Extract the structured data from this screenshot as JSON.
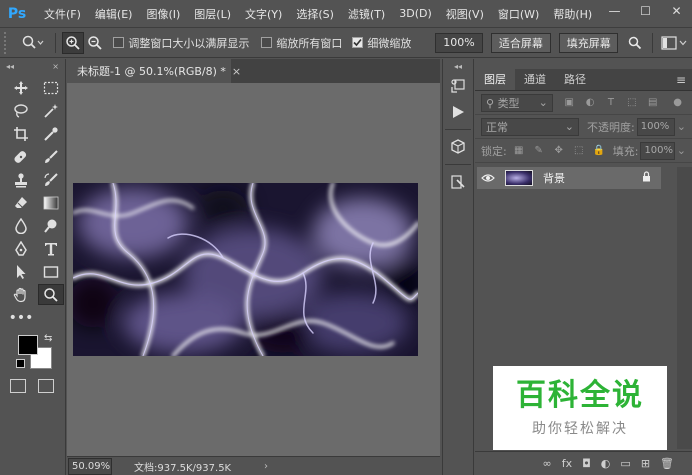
{
  "app": {
    "logo": "Ps"
  },
  "menu": [
    "文件(F)",
    "编辑(E)",
    "图像(I)",
    "图层(L)",
    "文字(Y)",
    "选择(S)",
    "滤镜(T)",
    "3D(D)",
    "视图(V)",
    "窗口(W)",
    "帮助(H)"
  ],
  "window_controls": {
    "minimize": "—",
    "maximize": "☐",
    "close": "✕"
  },
  "options": {
    "resize_window": {
      "label": "调整窗口大小以满屏显示",
      "checked": false
    },
    "zoom_all": {
      "label": "缩放所有窗口",
      "checked": false
    },
    "scrubby_zoom": {
      "label": "细微缩放",
      "checked": true
    },
    "zoom_value": "100%",
    "fit_screen": "适合屏幕",
    "fill_screen": "填充屏幕"
  },
  "document": {
    "tab_title": "未标题-1 @ 50.1%(RGB/8) *",
    "close": "×",
    "status_zoom": "50.09%",
    "status_info": "文档:937.5K/937.5K",
    "status_arrow": "›"
  },
  "layers_panel": {
    "tabs": [
      "图层",
      "通道",
      "路径"
    ],
    "filter_kind": "类型",
    "blend_mode": "正常",
    "opacity_label": "不透明度:",
    "opacity": "100%",
    "lock_label": "锁定:",
    "fill_label": "填充:",
    "fill": "100%",
    "layer_name": "背景"
  },
  "panel_bottom_icons": [
    "∞",
    "fx",
    "◘",
    "◐",
    "▭",
    "⊞",
    "🗑"
  ],
  "watermark": {
    "main": "百科全说",
    "sub": "助你轻松解决"
  },
  "colors": {
    "accent": "#31a8ff",
    "watermark_green": "#2db336"
  }
}
